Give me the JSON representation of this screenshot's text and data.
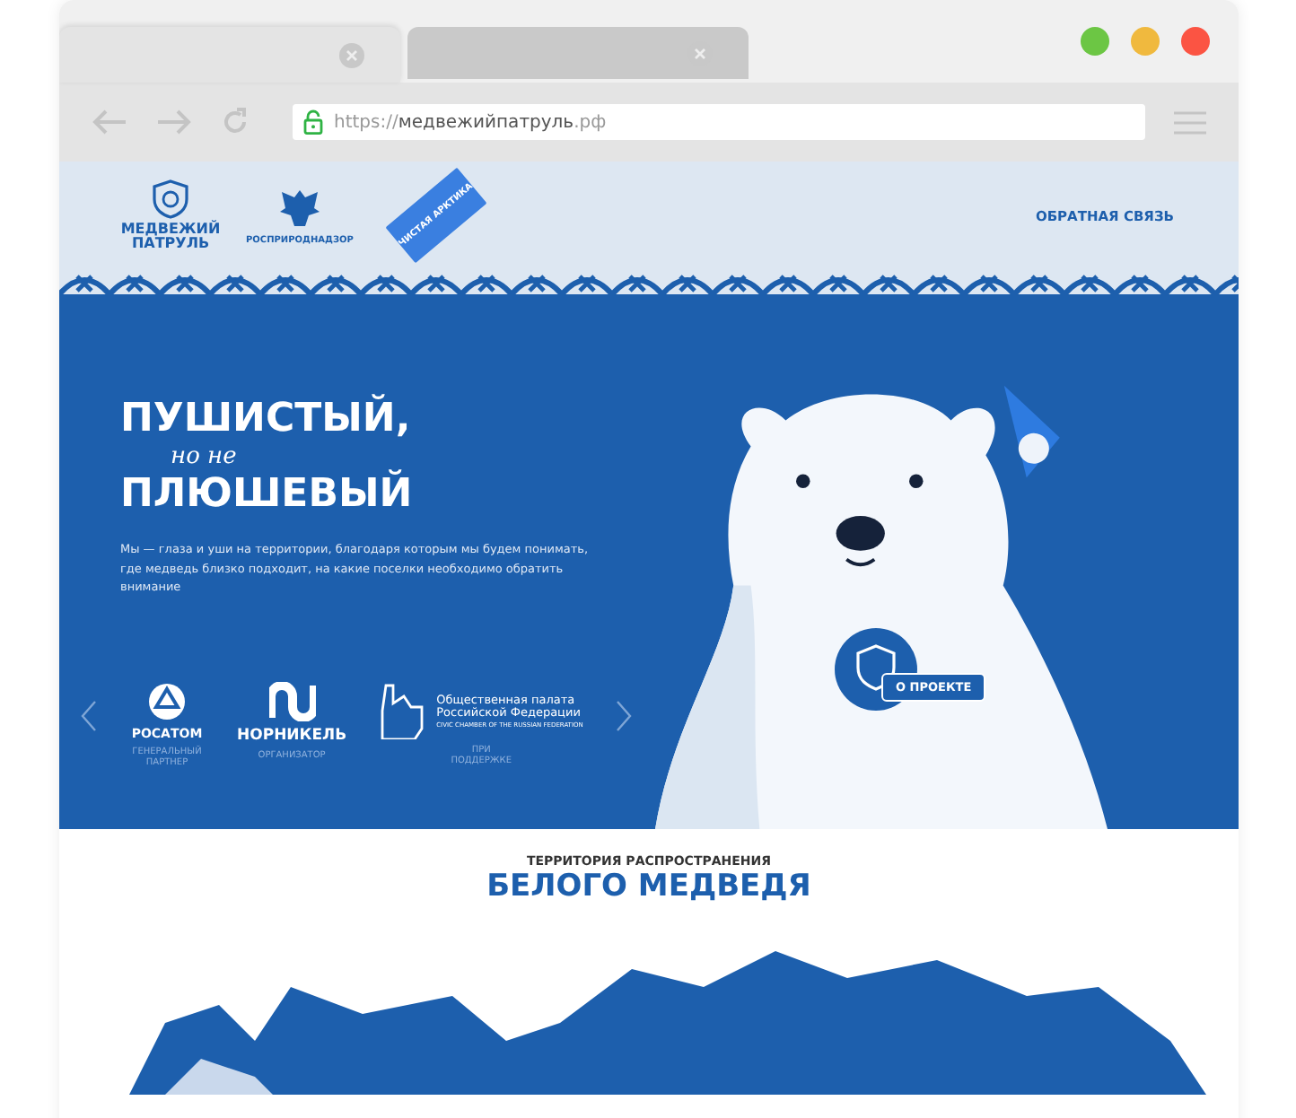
{
  "browser": {
    "tabs": [
      {
        "selected": true
      },
      {
        "selected": false
      }
    ],
    "url": {
      "scheme": "https://",
      "host": "медвежийпатруль",
      "tld": ".рф"
    }
  },
  "header": {
    "logos": [
      {
        "kind": "patrol",
        "text": "МЕДВЕЖИЙ ПАТРУЛЬ"
      },
      {
        "kind": "eagle",
        "text": "РОСПРИРОДНАДЗОР"
      },
      {
        "kind": "check",
        "text": "ЧИСТАЯ АРКТИКА"
      }
    ],
    "feedback_link": "ОБРАТНАЯ СВЯЗЬ"
  },
  "hero": {
    "title_top": "ПУШИСТЫЙ,",
    "title_script": "но не",
    "title_bottom": "ПЛЮШЕВЫЙ",
    "description": "Мы — глаза и уши на территории, благодаря которым мы будем понимать, где медведь близко подходит, на какие поселки необходимо обратить внимание",
    "partners": [
      {
        "kind": "rosatom",
        "name": "РОСАТОМ",
        "caption": "ГЕНЕРАЛЬНЫЙ ПАРТНЕР"
      },
      {
        "kind": "nornickel",
        "name": "НОРНИКЕЛЬ",
        "caption": "ОРГАНИЗАТОР"
      },
      {
        "kind": "chamber",
        "name_lines": [
          "Общественная палата",
          "Российской Федерации"
        ],
        "subtitle": "CIVIC CHAMBER OF THE RUSSIAN FEDERATION",
        "caption": "ПРИ ПОДДЕРЖКЕ"
      }
    ],
    "about_button": "О ПРОЕКТЕ"
  },
  "range": {
    "kicker": "ТЕРРИТОРИЯ РАСПРОСТРАНЕНИЯ",
    "title": "БЕЛОГО МЕДВЕДЯ"
  }
}
